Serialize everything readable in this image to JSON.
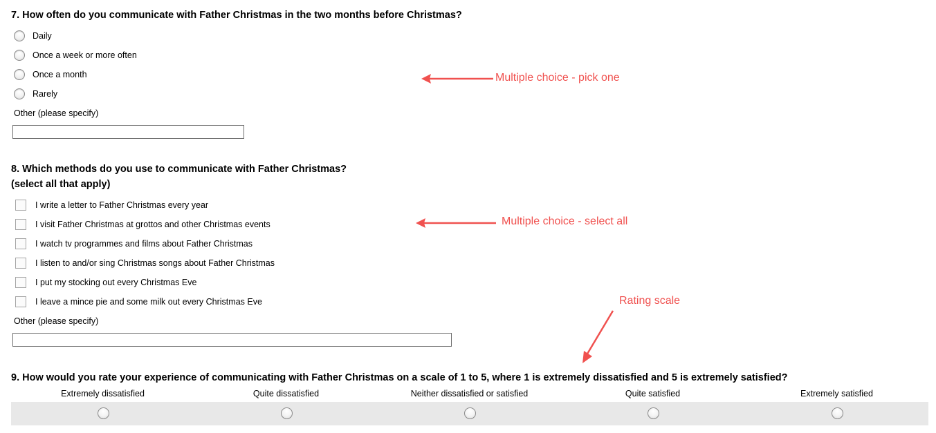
{
  "q7": {
    "title": "7. How often do you communicate with Father Christmas in the two months before Christmas?",
    "options": [
      "Daily",
      "Once a week or more often",
      "Once a month",
      "Rarely"
    ],
    "other_label": "Other (please specify)",
    "other_value": ""
  },
  "q8": {
    "title_line1": "8. Which methods do you use to communicate with Father Christmas?",
    "title_line2": "(select all that apply)",
    "options": [
      "I write a letter to Father Christmas every year",
      "I visit Father Christmas at grottos and other Christmas events",
      "I watch tv programmes and films about Father Christmas",
      "I listen to and/or sing Christmas songs about Father Christmas",
      "I put my stocking out every Christmas Eve",
      "I leave a mince pie and some milk out every Christmas Eve"
    ],
    "other_label": "Other (please specify)",
    "other_value": ""
  },
  "q9": {
    "title": "9. How would you rate your experience of communicating with Father Christmas on a scale of 1 to 5, where 1 is extremely dissatisfied and 5 is extremely satisfied?",
    "scale": [
      "Extremely dissatisfied",
      "Quite dissatisfied",
      "Neither dissatisfied or satisfied",
      "Quite satisfied",
      "Extremely satisfied"
    ]
  },
  "annotations": {
    "pick_one": "Multiple choice - pick one",
    "select_all": "Multiple choice - select all",
    "rating": "Rating scale",
    "color": "#f0514f"
  }
}
